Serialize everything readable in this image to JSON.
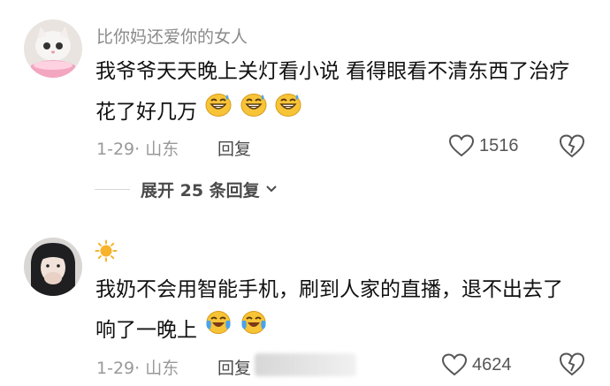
{
  "comments": [
    {
      "username": "比你妈还爱你的女人",
      "text": "我爷爷天天晚上关灯看小说 看得眼看不清东西了治疗花了好几万",
      "emojis": [
        "grin-sweat-emoji",
        "grin-sweat-emoji",
        "grin-sweat-emoji"
      ],
      "date_location": "1-29· 山东",
      "reply_label": "回复",
      "likes": "1516",
      "expand_label": "展开 25 条回复"
    },
    {
      "username": "",
      "username_icon": "sun-emoji",
      "text": "我奶不会用智能手机，刷到人家的直播，退不出去了 响了一晚上",
      "emojis": [
        "crying-laughing-emoji",
        "crying-laughing-emoji"
      ],
      "date_location": "1-29· 山东",
      "reply_label": "回复",
      "likes": "4624"
    }
  ],
  "colors": {
    "meta_gray": "#999999",
    "text": "#111111",
    "emoji_yellow": "#f8c437",
    "tear_blue": "#4aa3e8"
  }
}
